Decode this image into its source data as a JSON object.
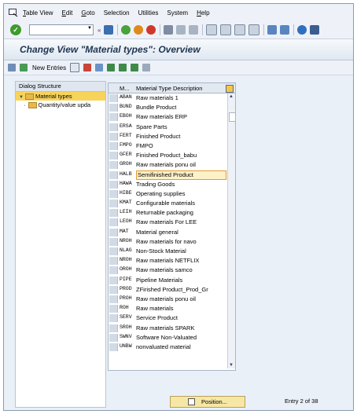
{
  "menubar": {
    "items": [
      "Table View",
      "Edit",
      "Goto",
      "Selection",
      "Utilities",
      "System",
      "Help"
    ],
    "underline": [
      "T",
      "E",
      "G",
      "",
      "",
      "",
      "H"
    ]
  },
  "toolbar": {
    "command_value": ""
  },
  "title": "Change View \"Material types\": Overview",
  "app_toolbar": {
    "new_entries_label": "New Entries"
  },
  "dialog_structure": {
    "header": "Dialog Structure",
    "items": [
      {
        "label": "Material types",
        "selected": true
      },
      {
        "label": "Quantity/value upda",
        "selected": false
      }
    ]
  },
  "table": {
    "columns": [
      "M...",
      "Material Type Description"
    ],
    "rows": [
      {
        "code": "ABAN",
        "desc": "Raw materials 1"
      },
      {
        "code": "BUND",
        "desc": "Bundle Product"
      },
      {
        "code": "EBOH",
        "desc": "Raw materials ERP"
      },
      {
        "code": "ERSA",
        "desc": "Spare Parts"
      },
      {
        "code": "FERT",
        "desc": "Finished Product"
      },
      {
        "code": "FMPO",
        "desc": "FMPO"
      },
      {
        "code": "GFER",
        "desc": "Finished Product_babu"
      },
      {
        "code": "GROH",
        "desc": "Raw materials ponu oil"
      },
      {
        "code": "HALB",
        "desc": "Semifinished Product",
        "active": true
      },
      {
        "code": "HAWA",
        "desc": "Trading Goods"
      },
      {
        "code": "HIBE",
        "desc": "Operating supplies"
      },
      {
        "code": "KMAT",
        "desc": "Configurable materials"
      },
      {
        "code": "LEIH",
        "desc": "Returnable packaging"
      },
      {
        "code": "LEOH",
        "desc": "Raw materials For LEE"
      },
      {
        "code": "MAT",
        "desc": "Material general"
      },
      {
        "code": "NROH",
        "desc": "Raw materials for navo"
      },
      {
        "code": "NLAG",
        "desc": "Non-Stock Material"
      },
      {
        "code": "NROH",
        "desc": "Raw materials NETFLIX"
      },
      {
        "code": "OROH",
        "desc": "Raw materials samco"
      },
      {
        "code": "PIPE",
        "desc": "Pipeline Materials"
      },
      {
        "code": "PROD",
        "desc": "ZFirished Product_Prod_Gr"
      },
      {
        "code": "PROH",
        "desc": "Raw materials ponu oil"
      },
      {
        "code": "ROH",
        "desc": "Raw materials"
      },
      {
        "code": "SERV",
        "desc": "Service Product"
      },
      {
        "code": "SROH",
        "desc": "Raw materials SPARK"
      },
      {
        "code": "SWNV",
        "desc": "Software Non-Valuated"
      },
      {
        "code": "UNBW",
        "desc": "nonvaluated material"
      }
    ]
  },
  "footer": {
    "position_button": "Position...",
    "entry_info": "Entry 2 of 38"
  },
  "colors": {
    "title_text": "#1f3550",
    "selected_tree": "#f8d35a",
    "position_button": "#f7e7a6"
  }
}
